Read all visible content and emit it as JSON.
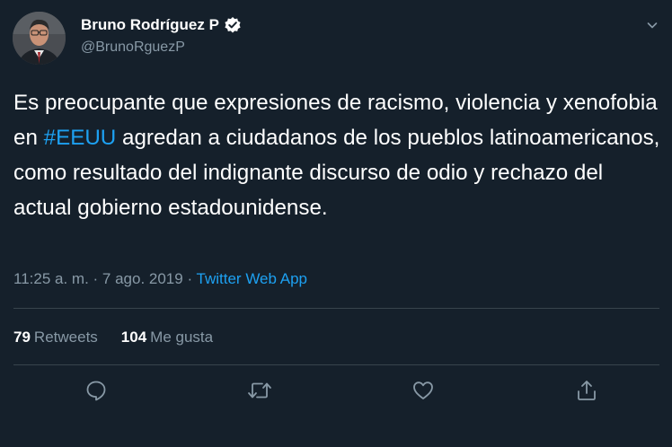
{
  "author": {
    "name": "Bruno Rodríguez P",
    "handle": "@BrunoRguezP"
  },
  "tweet": {
    "text_before": "Es preocupante que expresiones de racismo, violencia y xenofobia en ",
    "hashtag": "#EEUU",
    "text_after": " agredan a ciudadanos de los pueblos latinoamericanos, como resultado del indignante discurso de odio y rechazo del actual gobierno estadounidense."
  },
  "meta": {
    "time": "11:25 a. m.",
    "sep1": " · ",
    "date": "7 ago. 2019",
    "sep2": " · ",
    "source": "Twitter Web App"
  },
  "stats": {
    "retweets_count": "79",
    "retweets_label": "Retweets",
    "likes_count": "104",
    "likes_label": "Me gusta"
  },
  "icons": {
    "reply": "reply-icon",
    "retweet": "retweet-icon",
    "like": "like-icon",
    "share": "share-icon",
    "verified": "verified-badge-icon",
    "caret": "chevron-down-icon"
  },
  "colors": {
    "background": "#15202b",
    "accent": "#1da1f2",
    "secondary_text": "#8899a6",
    "divider": "#38444d"
  }
}
